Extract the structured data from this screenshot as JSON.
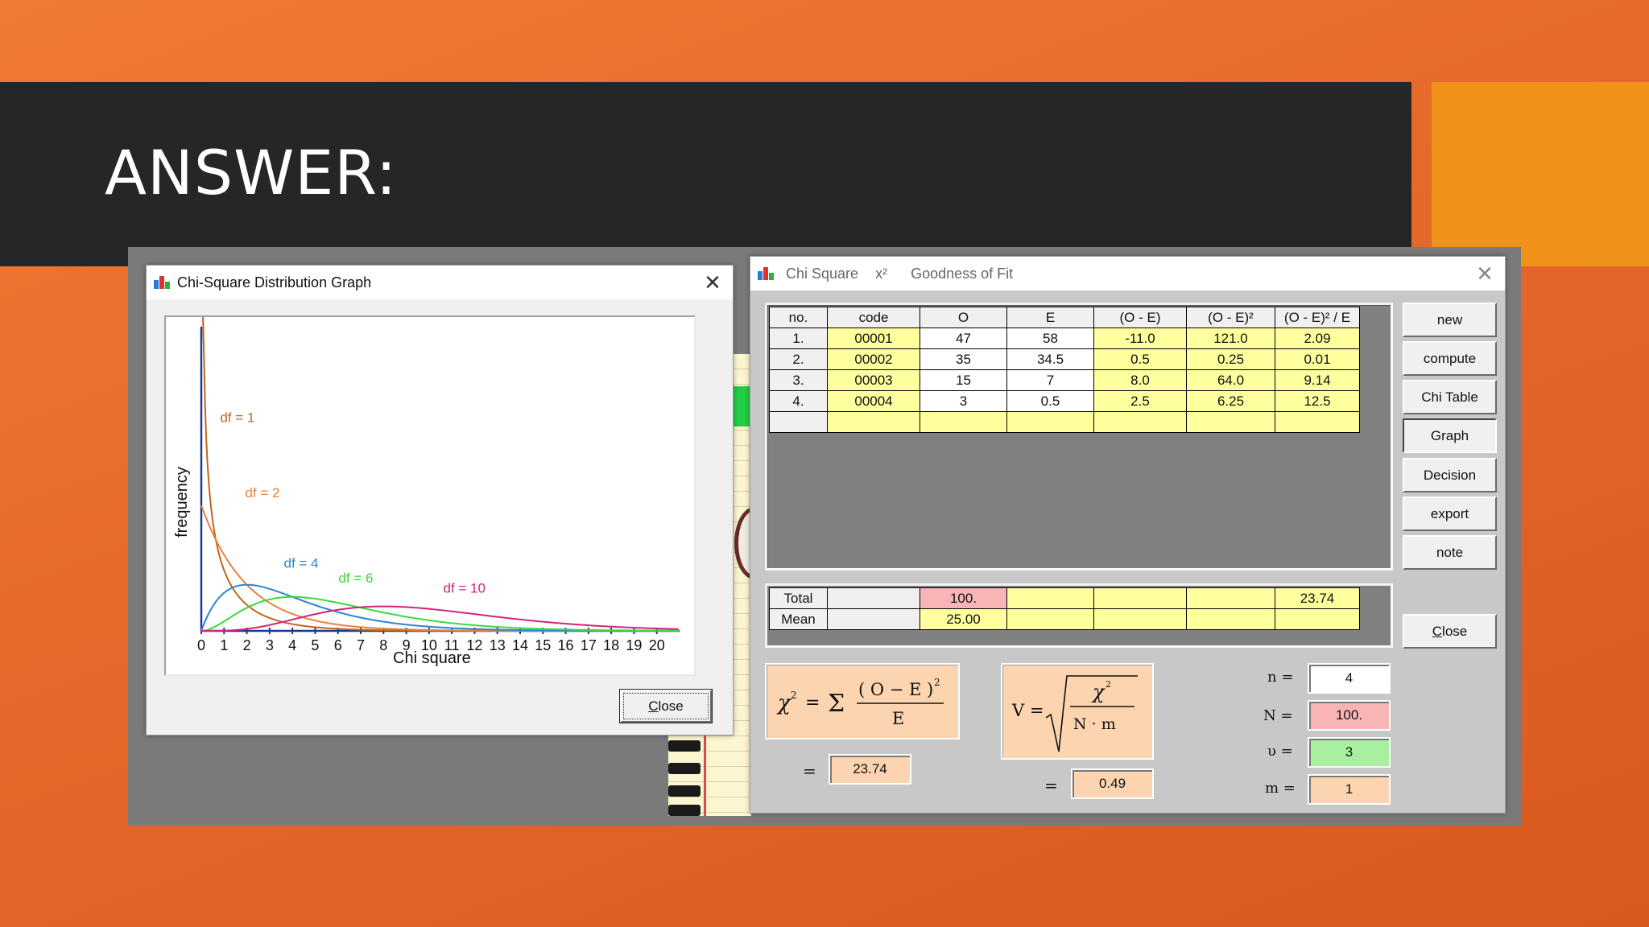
{
  "slide": {
    "title": "ANSWER:"
  },
  "graph_window": {
    "title": "Chi-Square Distribution Graph",
    "close_label": "Close"
  },
  "chart_data": {
    "type": "line",
    "xlabel": "Chi square",
    "ylabel": "frequency",
    "x_ticks": [
      "0",
      "1",
      "2",
      "3",
      "4",
      "5",
      "6",
      "7",
      "8",
      "9",
      "10",
      "11",
      "12",
      "13",
      "14",
      "15",
      "16",
      "17",
      "18",
      "19",
      "20"
    ],
    "xlim": [
      0,
      21
    ],
    "series": [
      {
        "name": "df = 1",
        "df": 1,
        "color": "#c0651f"
      },
      {
        "name": "df = 2",
        "df": 2,
        "color": "#e8823a"
      },
      {
        "name": "df = 4",
        "df": 4,
        "color": "#2a86d0"
      },
      {
        "name": "df = 6",
        "df": 6,
        "color": "#3ed83e"
      },
      {
        "name": "df = 10",
        "df": 10,
        "color": "#d4237a"
      }
    ]
  },
  "chi_window": {
    "title": "Chi Square",
    "title_symbol": "x²",
    "subtitle": "Goodness of Fit",
    "headers": [
      "no.",
      "code",
      "O",
      "E",
      "(O - E)",
      "(O - E)²",
      "(O - E)² / E"
    ],
    "rows": [
      [
        "1.",
        "00001",
        "47",
        "58",
        "-11.0",
        "121.0",
        "2.09"
      ],
      [
        "2.",
        "00002",
        "35",
        "34.5",
        "0.5",
        "0.25",
        "0.01"
      ],
      [
        "3.",
        "00003",
        "15",
        "7",
        "8.0",
        "64.0",
        "9.14"
      ],
      [
        "4.",
        "00004",
        "3",
        "0.5",
        "2.5",
        "6.25",
        "12.5"
      ]
    ],
    "total_label": "Total",
    "total_O": "100.",
    "total_last": "23.74",
    "mean_label": "Mean",
    "mean_O": "25.00",
    "buttons": [
      "new",
      "compute",
      "Chi Table",
      "Graph",
      "Decision",
      "export",
      "note"
    ],
    "close_label": "Close",
    "chi_formula_value": "23.74",
    "v_formula_value": "0.49",
    "n_label": "n =",
    "n_value": "4",
    "N_label": "N =",
    "N_value": "100.",
    "nu_label": "υ =",
    "nu_value": "3",
    "m_label": "m =",
    "m_value": "1",
    "eq_sign": "="
  }
}
